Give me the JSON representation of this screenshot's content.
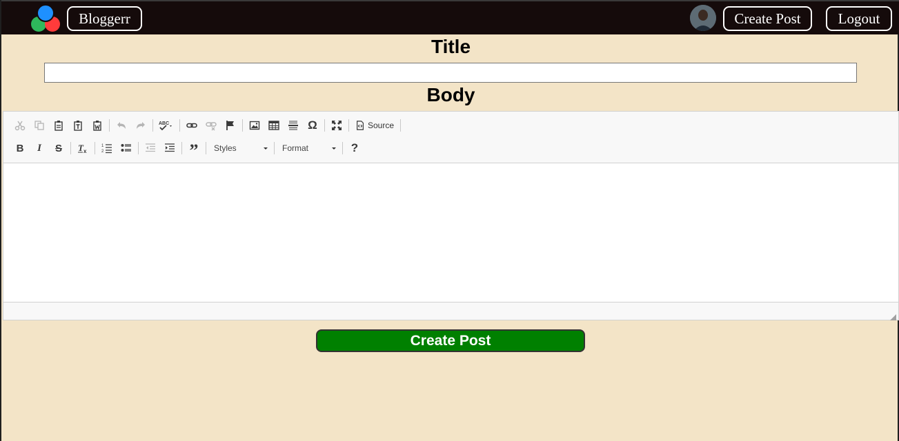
{
  "nav": {
    "brand_label": "Bloggerr",
    "create_post_label": "Create Post",
    "logout_label": "Logout",
    "logo_colors": [
      "#1e90ff",
      "#2eb85c",
      "#ff3b3b"
    ]
  },
  "form": {
    "title_heading": "Title",
    "title_value": "",
    "body_heading": "Body",
    "submit_label": "Create Post",
    "submit_color": "#008000"
  },
  "editor": {
    "toolbar_row1": [
      "cut-icon",
      "copy-icon",
      "paste-icon",
      "paste-text-icon",
      "paste-word-icon",
      "undo-icon",
      "redo-icon",
      "spellcheck-icon",
      "link-icon",
      "unlink-icon",
      "anchor-icon",
      "image-icon",
      "table-icon",
      "horizontal-line-icon",
      "special-char-icon",
      "maximize-icon"
    ],
    "source_label": "Source",
    "toolbar_row2": [
      "bold-icon",
      "italic-icon",
      "strikethrough-icon",
      "remove-format-icon",
      "numbered-list-icon",
      "bulleted-list-icon",
      "outdent-icon",
      "indent-icon",
      "blockquote-icon"
    ],
    "styles_label": "Styles",
    "format_label": "Format",
    "help_label": "?",
    "body_value": ""
  },
  "colors": {
    "background": "#f3e4c7",
    "navbar": "#150b0b"
  }
}
